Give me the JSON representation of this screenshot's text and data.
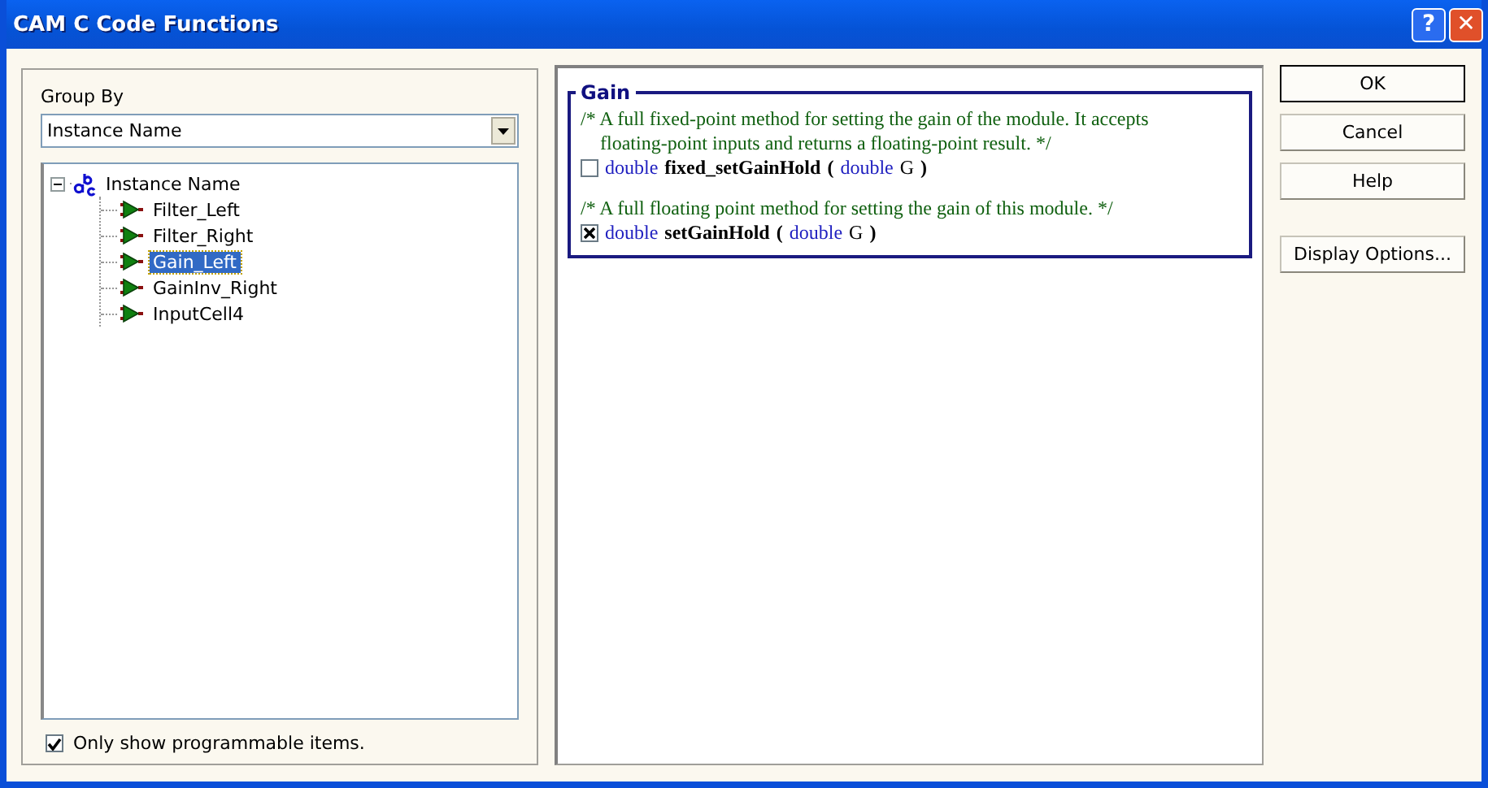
{
  "window": {
    "title": "CAM C Code Functions",
    "title_buttons": [
      "?",
      "✕"
    ]
  },
  "group_by": {
    "label": "Group By",
    "value": "Instance Name"
  },
  "tree": [
    {
      "label": "Instance Name",
      "expanded": true,
      "selected": false,
      "children": [
        {
          "label": "Filter_Left",
          "selected": false
        },
        {
          "label": "Filter_Right",
          "selected": false
        },
        {
          "label": "Gain_Left",
          "selected": true
        },
        {
          "label": "GainInv_Right",
          "selected": false
        },
        {
          "label": "InputCell4",
          "selected": false
        }
      ]
    }
  ],
  "only_programmable": {
    "label": "Only show programmable items.",
    "checked": true
  },
  "section": {
    "title": "Gain",
    "functions": [
      {
        "comment_lines": [
          "/* A full fixed-point method for setting the gain of the module. It accepts",
          "floating-point inputs and returns a floating-point result.  */"
        ],
        "checked": false,
        "signature": [
          {
            "kind": "type",
            "text": "double"
          },
          {
            "kind": "name",
            "text": "fixed_setGainHold"
          },
          {
            "kind": "punct",
            "text": "("
          },
          {
            "kind": "type",
            "text": "double"
          },
          {
            "kind": "plain",
            "text": "G"
          },
          {
            "kind": "punct",
            "text": ")"
          }
        ]
      },
      {
        "comment_lines": [
          "/* A full floating point method for setting the gain of this module.  */"
        ],
        "checked": true,
        "signature": [
          {
            "kind": "type",
            "text": "double"
          },
          {
            "kind": "name",
            "text": "setGainHold"
          },
          {
            "kind": "punct",
            "text": "("
          },
          {
            "kind": "type",
            "text": "double"
          },
          {
            "kind": "plain",
            "text": "G"
          },
          {
            "kind": "punct",
            "text": ")"
          }
        ]
      }
    ]
  },
  "buttons": [
    {
      "label": "OK",
      "default": true
    },
    {
      "label": "Cancel",
      "default": false
    },
    {
      "label": "Help",
      "default": false
    },
    {
      "label": "Display Options...",
      "default": false
    }
  ]
}
